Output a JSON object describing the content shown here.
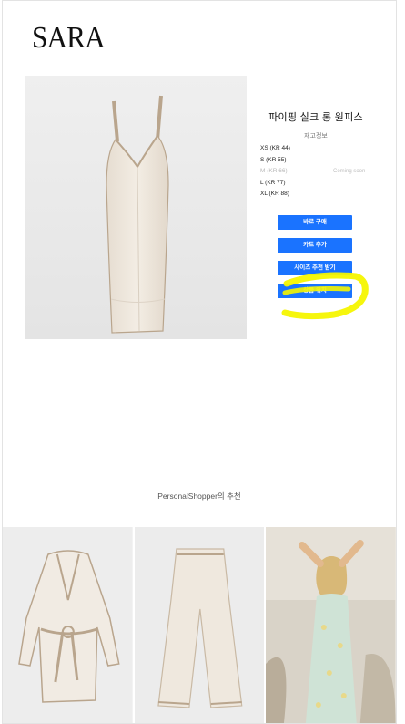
{
  "brand": {
    "logo_text": "SARA"
  },
  "product": {
    "title": "파이핑 실크 롱 원피스",
    "stock_label": "재고정보",
    "sizes": [
      {
        "label": "XS (KR 44)",
        "available": true,
        "note": ""
      },
      {
        "label": "S (KR 55)",
        "available": true,
        "note": ""
      },
      {
        "label": "M (KR 66)",
        "available": false,
        "note": "Coming soon"
      },
      {
        "label": "L (KR 77)",
        "available": true,
        "note": ""
      },
      {
        "label": "XL (KR 88)",
        "available": true,
        "note": ""
      }
    ]
  },
  "actions": {
    "buy_now": "바로 구매",
    "add_to_cart": "카트 추가",
    "size_recommend": "사이즈 추천 받기",
    "product_wish": "상품 위치"
  },
  "recommendations": {
    "title": "PersonalShopper의 추천",
    "items": [
      {
        "icon": "robe-photo"
      },
      {
        "icon": "pants-photo"
      },
      {
        "icon": "model-photo"
      }
    ]
  },
  "colors": {
    "accent": "#1a73ff",
    "highlighter": "#f5f500",
    "fabric": "#efe8de",
    "piping": "#b9a58d"
  }
}
